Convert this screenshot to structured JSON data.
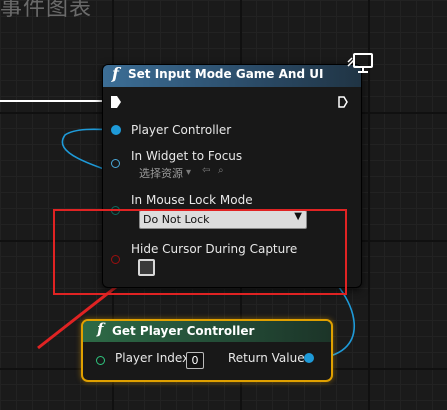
{
  "graph": {
    "title": "事件图表"
  },
  "node_set_input_mode": {
    "title": "Set Input Mode Game And UI",
    "pins": {
      "player_controller": "Player Controller",
      "in_widget_to_focus": "In Widget to Focus",
      "asset_picker": "选择资源",
      "in_mouse_lock_mode": "In Mouse Lock Mode",
      "mouse_lock_value": "Do Not Lock",
      "hide_cursor": "Hide Cursor During Capture"
    },
    "hide_cursor_checked": false
  },
  "node_get_player_controller": {
    "title": "Get Player Controller",
    "pins": {
      "player_index": "Player Index",
      "player_index_value": "0",
      "return_value": "Return Value"
    }
  },
  "colors": {
    "function_header": "#3c6e96",
    "pure_header": "#2d6a46",
    "selection": "#e0a000",
    "annotation": "#e02323",
    "object_pin": "#1e9ad8",
    "int_pin": "#2fc67f",
    "byte_pin": "#0c6a5e",
    "bool_pin": "#9c0f0f"
  },
  "icons": [
    "function-icon",
    "network-icon",
    "exec-pin-icon",
    "dropdown-arrow-icon",
    "back-arrow-icon",
    "search-icon"
  ]
}
